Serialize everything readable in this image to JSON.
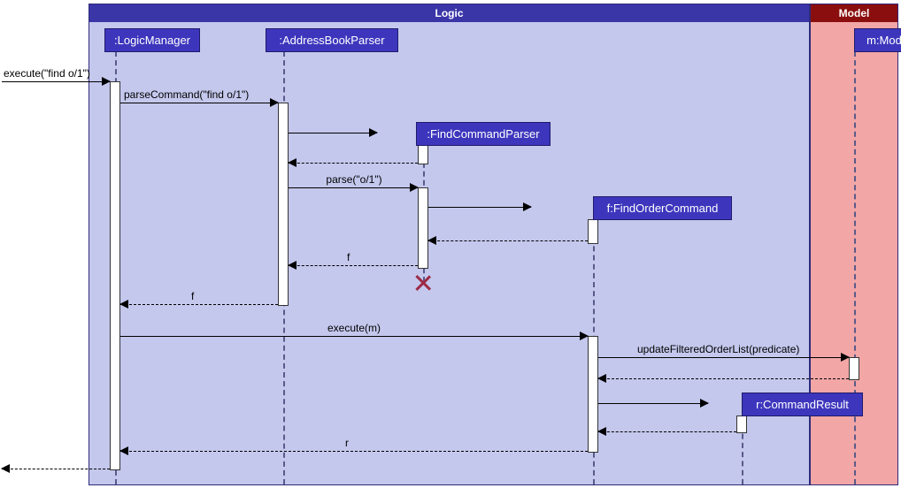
{
  "frames": {
    "logic": {
      "label": "Logic"
    },
    "model": {
      "label": "Model"
    }
  },
  "participants": {
    "logicManager": {
      "name": ":LogicManager"
    },
    "addressBookParser": {
      "name": ":AddressBookParser"
    },
    "findCommandParser": {
      "name": ":FindCommandParser"
    },
    "findOrderCommand": {
      "name": "f:FindOrderCommand"
    },
    "commandResult": {
      "name": "r:CommandResult"
    },
    "model": {
      "name": "m:Model"
    }
  },
  "messages": {
    "execute_in": {
      "text": "execute(\"find o/1\")"
    },
    "parseCommand": {
      "text": "parseCommand(\"find o/1\")"
    },
    "parse": {
      "text": "parse(\"o/1\")"
    },
    "return_f_parser": {
      "text": "f"
    },
    "return_f_abp": {
      "text": "f"
    },
    "execute_m": {
      "text": "execute(m)"
    },
    "updateFiltered": {
      "text": "updateFilteredOrderList(predicate)"
    },
    "return_r": {
      "text": "r"
    }
  },
  "chart_data": {
    "type": "sequence-diagram",
    "frames": [
      {
        "name": "Logic",
        "participants": [
          "LogicManager",
          "AddressBookParser",
          "FindCommandParser",
          "FindOrderCommand",
          "CommandResult"
        ]
      },
      {
        "name": "Model",
        "participants": [
          "Model"
        ]
      }
    ],
    "participants": [
      {
        "id": "LogicManager",
        "label": ":LogicManager"
      },
      {
        "id": "AddressBookParser",
        "label": ":AddressBookParser"
      },
      {
        "id": "FindCommandParser",
        "label": ":FindCommandParser",
        "created_by_msg": "parseCommand",
        "destroyed": true
      },
      {
        "id": "FindOrderCommand",
        "label": "f:FindOrderCommand",
        "created_by_msg": "parse"
      },
      {
        "id": "Model",
        "label": "m:Model"
      },
      {
        "id": "CommandResult",
        "label": "r:CommandResult",
        "created_by_msg": "execute(m)-new"
      }
    ],
    "messages": [
      {
        "from": "external",
        "to": "LogicManager",
        "label": "execute(\"find o/1\")",
        "type": "sync"
      },
      {
        "from": "LogicManager",
        "to": "AddressBookParser",
        "label": "parseCommand(\"find o/1\")",
        "type": "sync"
      },
      {
        "from": "AddressBookParser",
        "to": "FindCommandParser",
        "label": "",
        "type": "create"
      },
      {
        "from": "FindCommandParser",
        "to": "AddressBookParser",
        "label": "",
        "type": "return"
      },
      {
        "from": "AddressBookParser",
        "to": "FindCommandParser",
        "label": "parse(\"o/1\")",
        "type": "sync"
      },
      {
        "from": "FindCommandParser",
        "to": "FindOrderCommand",
        "label": "",
        "type": "create"
      },
      {
        "from": "FindOrderCommand",
        "to": "FindCommandParser",
        "label": "",
        "type": "return"
      },
      {
        "from": "FindCommandParser",
        "to": "AddressBookParser",
        "label": "f",
        "type": "return"
      },
      {
        "from": "FindCommandParser",
        "to": null,
        "label": "X",
        "type": "destroy"
      },
      {
        "from": "AddressBookParser",
        "to": "LogicManager",
        "label": "f",
        "type": "return"
      },
      {
        "from": "LogicManager",
        "to": "FindOrderCommand",
        "label": "execute(m)",
        "type": "sync"
      },
      {
        "from": "FindOrderCommand",
        "to": "Model",
        "label": "updateFilteredOrderList(predicate)",
        "type": "sync"
      },
      {
        "from": "Model",
        "to": "FindOrderCommand",
        "label": "",
        "type": "return"
      },
      {
        "from": "FindOrderCommand",
        "to": "CommandResult",
        "label": "",
        "type": "create"
      },
      {
        "from": "CommandResult",
        "to": "FindOrderCommand",
        "label": "",
        "type": "return"
      },
      {
        "from": "FindOrderCommand",
        "to": "LogicManager",
        "label": "r",
        "type": "return"
      },
      {
        "from": "LogicManager",
        "to": "external",
        "label": "",
        "type": "return"
      }
    ]
  }
}
